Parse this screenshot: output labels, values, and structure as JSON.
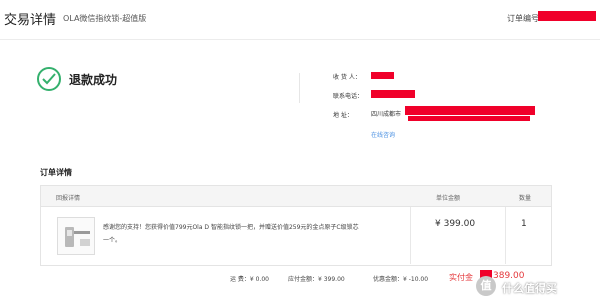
{
  "header": {
    "title": "交易详情",
    "subtitle": "OLA微信指纹锁-超值版",
    "order_no_label": "订单编号"
  },
  "status": {
    "icon": "check-circle-icon",
    "text": "退款成功",
    "color": "#34b06d"
  },
  "recipient": {
    "name_label": "收 货 人：",
    "phone_label": "联系电话：",
    "address_label": "地    址：",
    "address_prefix": "四川成都市",
    "consult_link": "在线咨询"
  },
  "order_detail": {
    "section_title": "订单详情",
    "columns": [
      "回报详情",
      "单位金额",
      "数量"
    ],
    "item": {
      "description": "感谢您的支持！您获得价值799元Ola D 智能指纹锁一把，并赠送价值259元的金点原子C级锁芯一个。",
      "price": "¥ 399.00",
      "quantity": "1"
    }
  },
  "summary": {
    "shipping": "运 费：¥ 0.00",
    "payable": "应付金额：¥ 399.00",
    "discount": "优惠金额：¥ -10.00",
    "paid_label": "实付金",
    "paid_value": "389.00"
  },
  "watermark": {
    "logo": "值",
    "text": "什么值得买"
  },
  "colors": {
    "redaction": "#f0002a",
    "accent_red": "#e4393c",
    "link_blue": "#4a90e2"
  }
}
